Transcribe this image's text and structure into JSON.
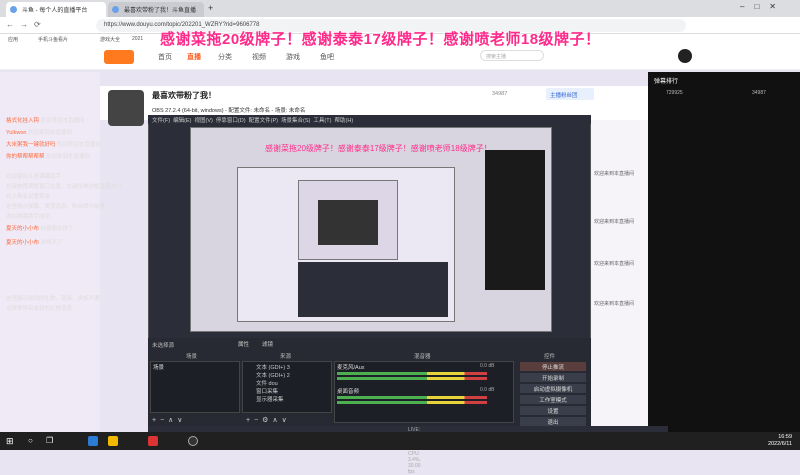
{
  "browser": {
    "tabs": [
      {
        "label": "斗鱼 - 每个人的直播平台"
      },
      {
        "label": "最喜欢带粉了我！斗鱼直播"
      }
    ],
    "url": "https://www.douyu.com/topic/202201_WZRY?rid=9606778",
    "bookmarks": [
      "应用",
      "手机斗鱼看片",
      "游戏大全",
      "2021"
    ]
  },
  "site": {
    "nav": [
      "首页",
      "直播",
      "分类",
      "视频",
      "游戏",
      "鱼吧"
    ],
    "search_placeholder": "搜索主播",
    "banner_text": "感谢菜拖20级牌子！感谢泰泰17级牌子！感谢喷老师18级牌子！"
  },
  "room": {
    "title": "最喜欢带粉了我！",
    "follow_count": "34987",
    "follow_label": "主播粉丝团"
  },
  "chat": {
    "header": "弹幕排行",
    "stats": [
      "729925",
      "34987"
    ],
    "lines": [
      {
        "user": "格式化挂入钩",
        "text": "欢迎来到本直播间"
      },
      {
        "user": "Yulkwon",
        "text": "欢迎来到本直播间"
      },
      {
        "user": "大米粥我一键就好吗",
        "text": "欢迎来到本直播间"
      },
      {
        "user": "你的帮帮帮帮帮",
        "text": "欢迎来到本直播间"
      },
      {
        "user": "",
        "text": "欢迎使用斗鱼弹幕助手"
      },
      {
        "user": "",
        "text": "左键拖拽调整窗口位置，左键拉伸边框改变大小"
      },
      {
        "user": "",
        "text": "右上角有设置菜单"
      },
      {
        "user": "",
        "text": "这里展示弹幕、赞赏消息、粉丝牌升级等"
      },
      {
        "user": "",
        "text": "添加弹幕助手成功"
      },
      {
        "user": "夏天的小小布",
        "text": "标题都这样了"
      },
      {
        "user": "夏天的小小布",
        "text": "冲鸭不了"
      },
      {
        "user": "",
        "text": "这里展示收到的礼物、道具、贵族开通"
      },
      {
        "user": "",
        "text": "点赞等所有收到的礼物消息"
      }
    ]
  },
  "obs": {
    "window_title": "OBS 27.2.4 (64-bit, windows) - 配置文件: 未命名 - 场景: 未命名",
    "menu": [
      "文件(F)",
      "编辑(E)",
      "视图(V)",
      "停靠窗口(D)",
      "配置文件(P)",
      "场景集合(S)",
      "工具(T)",
      "帮助(H)"
    ],
    "preview_banner": "感谢菜拖20级牌子！感谢泰泰17级牌子！感谢喷老师18级牌子！",
    "status_label": "未选择源",
    "tabs": [
      "属性",
      "滤镜"
    ],
    "dock_headers": [
      "场景",
      "来源",
      "混音器",
      "控件"
    ],
    "scenes": [
      "场景"
    ],
    "sources": [
      "文本 (GDI+) 3",
      "文本 (GDI+) 2",
      "文件 dou",
      "窗口采集",
      "显示器采集"
    ],
    "mixer": [
      {
        "name": "麦克风/Aux",
        "level": "0.0 dB"
      },
      {
        "name": "桌面音频",
        "level": "0.0 dB"
      }
    ],
    "controls": [
      "停止推流",
      "开始录制",
      "启动虚拟摄像机",
      "工作室模式",
      "设置",
      "退出"
    ],
    "statusbar": "LIVE: 00:00:00  REC: 00:00:00  CPU: 3.4%, 30.00 fps"
  },
  "taskbar": {
    "time": "16:59",
    "date": "2022/6/11"
  },
  "colors": {
    "banner": "#ff2a8a",
    "accent": "#ff5d23",
    "obs_bg": "#2b2e38",
    "chat_bg": "#111111"
  }
}
